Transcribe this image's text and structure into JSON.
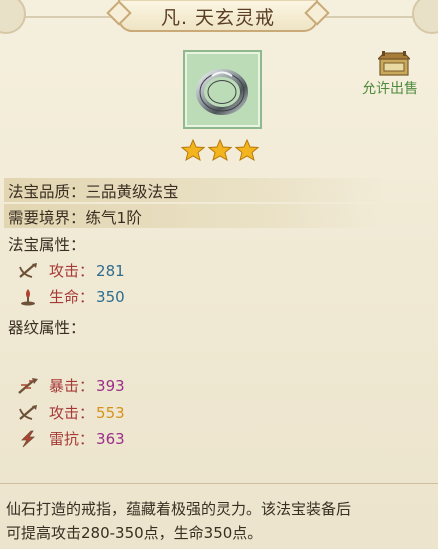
{
  "title": "凡. 天玄灵戒",
  "sale_label": "允许出售",
  "stars": 3,
  "colors": {
    "attr_name": "#a63a38",
    "attack_base": "#2f6d8f",
    "health_base": "#2f6d8f",
    "crit": "#9b2f8a",
    "attack_bonus": "#d4941c",
    "thunder": "#9b2f8a",
    "sale": "#4f8a3c"
  },
  "info": {
    "quality_label": "法宝品质：",
    "quality_value": "三品黄级法宝",
    "realm_label": "需要境界：",
    "realm_value": "练气1阶"
  },
  "base_section": "法宝属性：",
  "base_attrs": [
    {
      "name": "攻击",
      "value": "281",
      "icon": "attack-icon"
    },
    {
      "name": "生命",
      "value": "350",
      "icon": "health-icon"
    }
  ],
  "pattern_section": "器纹属性：",
  "pattern_attrs": [
    {
      "name": "暴击",
      "value": "393",
      "icon": "crit-icon"
    },
    {
      "name": "攻击",
      "value": "553",
      "icon": "attack-icon"
    },
    {
      "name": "雷抗",
      "value": "363",
      "icon": "lightning-icon"
    }
  ],
  "colon": "：",
  "description": {
    "line1": "仙石打造的戒指，蕴藏着极强的灵力。该法宝装备后",
    "line2": "可提高攻击280-350点，生命350点。"
  }
}
